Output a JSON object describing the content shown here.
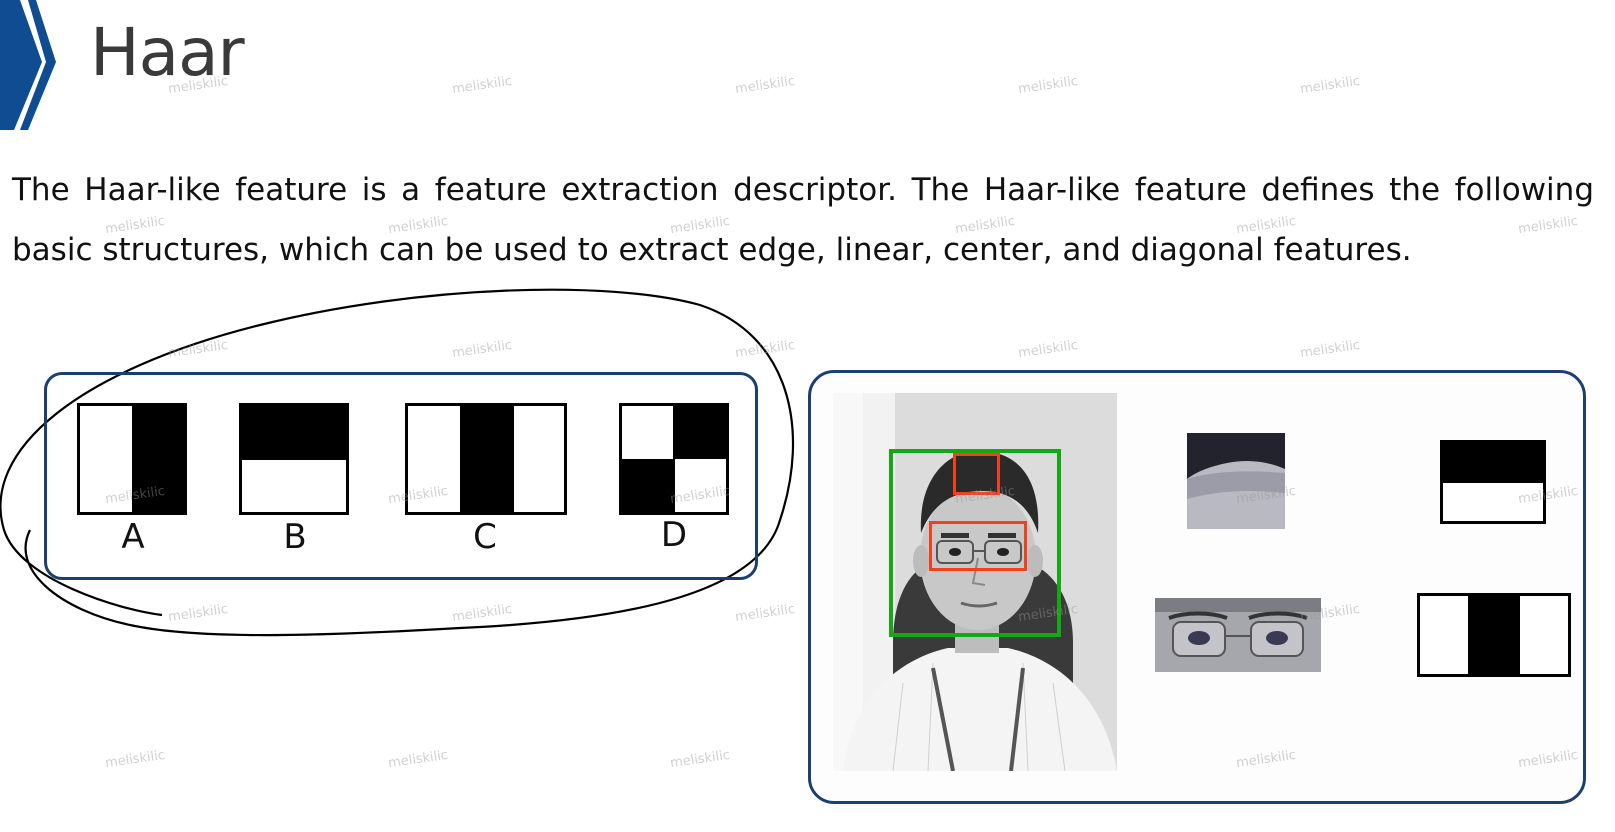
{
  "slide": {
    "title": "Haar",
    "body": "The Haar-like feature is a feature extraction descriptor. The Haar-like feature defines the following basic structures, which can be used to extract edge, linear, center, and diagonal features.",
    "accent_color": "#0f4c92"
  },
  "feature_panel": {
    "labels": [
      "A",
      "B",
      "C",
      "D"
    ],
    "border_color": "#1c3f72"
  },
  "example_panel": {
    "face_box_color": "#14a814",
    "region_box_color": "#f04020"
  },
  "watermark": "meliskilic"
}
